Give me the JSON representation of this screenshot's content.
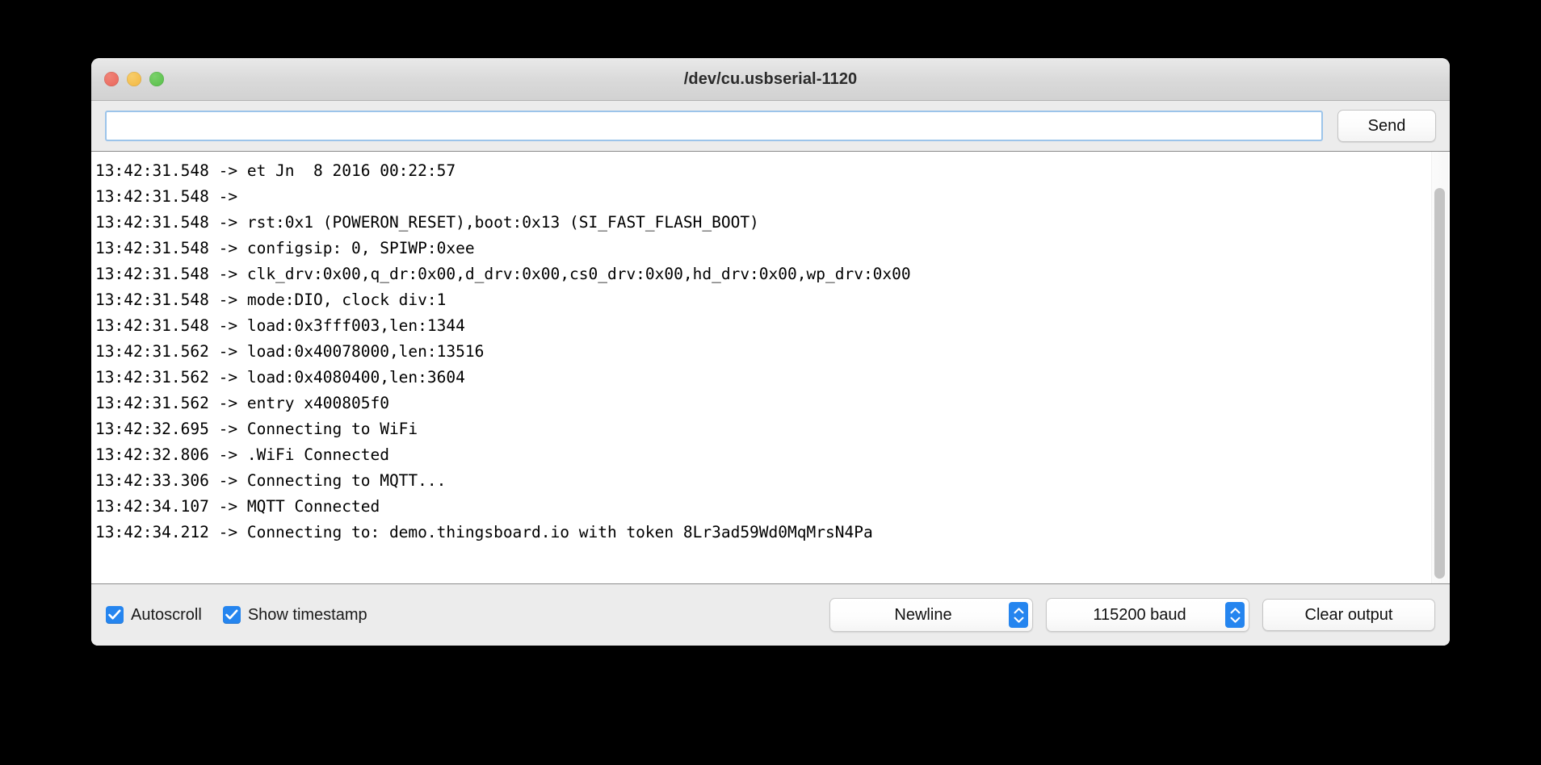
{
  "window": {
    "title": "/dev/cu.usbserial-1120",
    "traffic_lights": [
      {
        "name": "close",
        "color": "#e9655a"
      },
      {
        "name": "minimize",
        "color": "#f2b63f"
      },
      {
        "name": "zoom",
        "color": "#55be47"
      }
    ]
  },
  "send_row": {
    "input_value": "",
    "input_placeholder": "",
    "send_label": "Send"
  },
  "console": {
    "lines": [
      "13:42:31.548 -> et Jn  8 2016 00:22:57",
      "13:42:31.548 -> ",
      "13:42:31.548 -> rst:0x1 (POWERON_RESET),boot:0x13 (SI_FAST_FLASH_BOOT)",
      "13:42:31.548 -> configsip: 0, SPIWP:0xee",
      "13:42:31.548 -> clk_drv:0x00,q_dr:0x00,d_drv:0x00,cs0_drv:0x00,hd_drv:0x00,wp_drv:0x00",
      "13:42:31.548 -> mode:DIO, clock div:1",
      "13:42:31.548 -> load:0x3fff003,len:1344",
      "13:42:31.562 -> load:0x40078000,len:13516",
      "13:42:31.562 -> load:0x4080400,len:3604",
      "13:42:31.562 -> entry x400805f0",
      "13:42:32.695 -> Connecting to WiFi",
      "13:42:32.806 -> .WiFi Connected",
      "13:42:33.306 -> Connecting to MQTT...",
      "13:42:34.107 -> MQTT Connected",
      "13:42:34.212 -> Connecting to: demo.thingsboard.io with token 8Lr3ad59Wd0MqMrsN4Pa"
    ]
  },
  "bottom_bar": {
    "autoscroll": {
      "label": "Autoscroll",
      "checked": true
    },
    "show_timestamp": {
      "label": "Show timestamp",
      "checked": true
    },
    "line_ending": {
      "selected": "Newline"
    },
    "baud_rate": {
      "selected": "115200 baud"
    },
    "clear_output_label": "Clear output"
  },
  "colors": {
    "accent_blue": "#2585ef",
    "focus_border": "#9cc4ea",
    "window_chrome": "#ececec",
    "console_background": "#ffffff",
    "console_text": "#000000"
  }
}
